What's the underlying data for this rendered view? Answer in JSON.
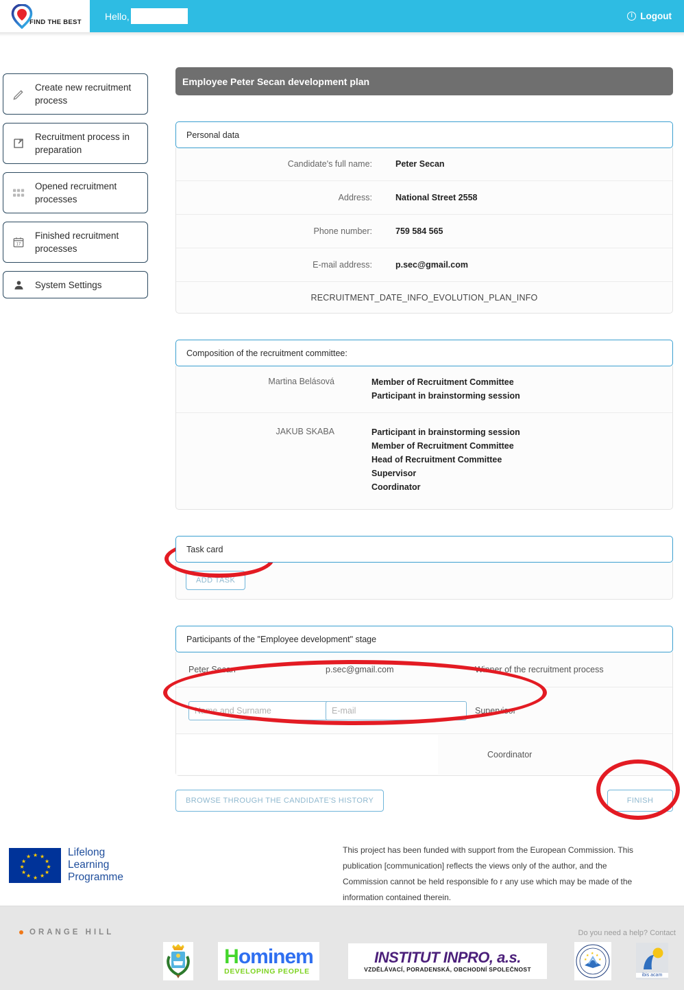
{
  "topbar": {
    "logo_text": "FIND THE BEST",
    "greeting": "Hello,",
    "logout_label": "Logout"
  },
  "sidebar": {
    "items": [
      {
        "label": "Create new recruitment process",
        "icon": "pencil-icon"
      },
      {
        "label": "Recruitment process in preparation",
        "icon": "edit-square-icon"
      },
      {
        "label": "Opened recruitment processes",
        "icon": "grid-icon"
      },
      {
        "label": "Finished recruitment processes",
        "icon": "calendar-icon"
      },
      {
        "label": "System Settings",
        "icon": "user-icon"
      }
    ]
  },
  "main": {
    "page_title": "Employee Peter Secan development plan",
    "personal_data": {
      "heading": "Personal data",
      "rows": [
        {
          "label": "Candidate's full name:",
          "value": "Peter Secan"
        },
        {
          "label": "Address:",
          "value": "National Street 2558"
        },
        {
          "label": "Phone number:",
          "value": "759 584 565"
        },
        {
          "label": "E-mail address:",
          "value": "p.sec@gmail.com"
        }
      ],
      "footer_note": "RECRUITMENT_DATE_INFO_EVOLUTION_PLAN_INFO"
    },
    "committee": {
      "heading": "Composition of the recruitment committee:",
      "members": [
        {
          "name": "Martina Belásová",
          "roles": "Member of Recruitment Committee\nParticipant in brainstorming session"
        },
        {
          "name": "JAKUB SKABA",
          "roles": "Participant in brainstorming session\nMember of Recruitment Committee\nHead of Recruitment Committee\nSupervisor\nCoordinator"
        }
      ]
    },
    "task_card": {
      "heading": "Task card",
      "add_task_label": "ADD TASK"
    },
    "participants": {
      "heading": "Participants of the \"Employee development\" stage",
      "winner_row": {
        "name": "Peter Secan",
        "email": "p.sec@gmail.com",
        "role": "Winner of the recruitment process"
      },
      "supervisor_row": {
        "name_placeholder": "Name and Surname",
        "name_value": "",
        "email_placeholder": "E-mail",
        "email_value": "",
        "role": "Supervisor"
      },
      "coordinator_row": {
        "role": "Coordinator"
      }
    },
    "actions": {
      "history_label": "BROWSE THROUGH THE CANDIDATE'S HISTORY",
      "finish_label": "FINISH"
    }
  },
  "eu_block": {
    "logo_line1": "Lifelong",
    "logo_line2": "Learning",
    "logo_line3": "Programme",
    "disclaimer": "This project has been funded with support from the European Commission. This publication [communication] reflects the views only of the author, and the Commission cannot be held responsible fo r any use which may be made of the information contained therein."
  },
  "footer": {
    "brand": "ORANGE HILL",
    "help_text": "Do you need a help? Contact",
    "logos": [
      {
        "name": "city-crest-logo",
        "text": ""
      },
      {
        "name": "hominem-logo",
        "main_h": "H",
        "main_rest": "ominem",
        "sub": "DEVELOPING PEOPLE"
      },
      {
        "name": "institut-inpro-logo",
        "main": "INSTITUT INPRO, a.s.",
        "sub": "VZDĚLÁVACÍ, PORADENSKÁ, OBCHODNÍ SPOLEČNOST"
      },
      {
        "name": "european-institute-seal-logo",
        "text": ""
      },
      {
        "name": "ibis-acam-logo",
        "text": "ibis acam"
      }
    ]
  },
  "colors": {
    "accent": "#2ebce3",
    "panel_border": "#3a9fd0",
    "title_bar": "#6f6f6f",
    "annotation": "#e31b23"
  }
}
